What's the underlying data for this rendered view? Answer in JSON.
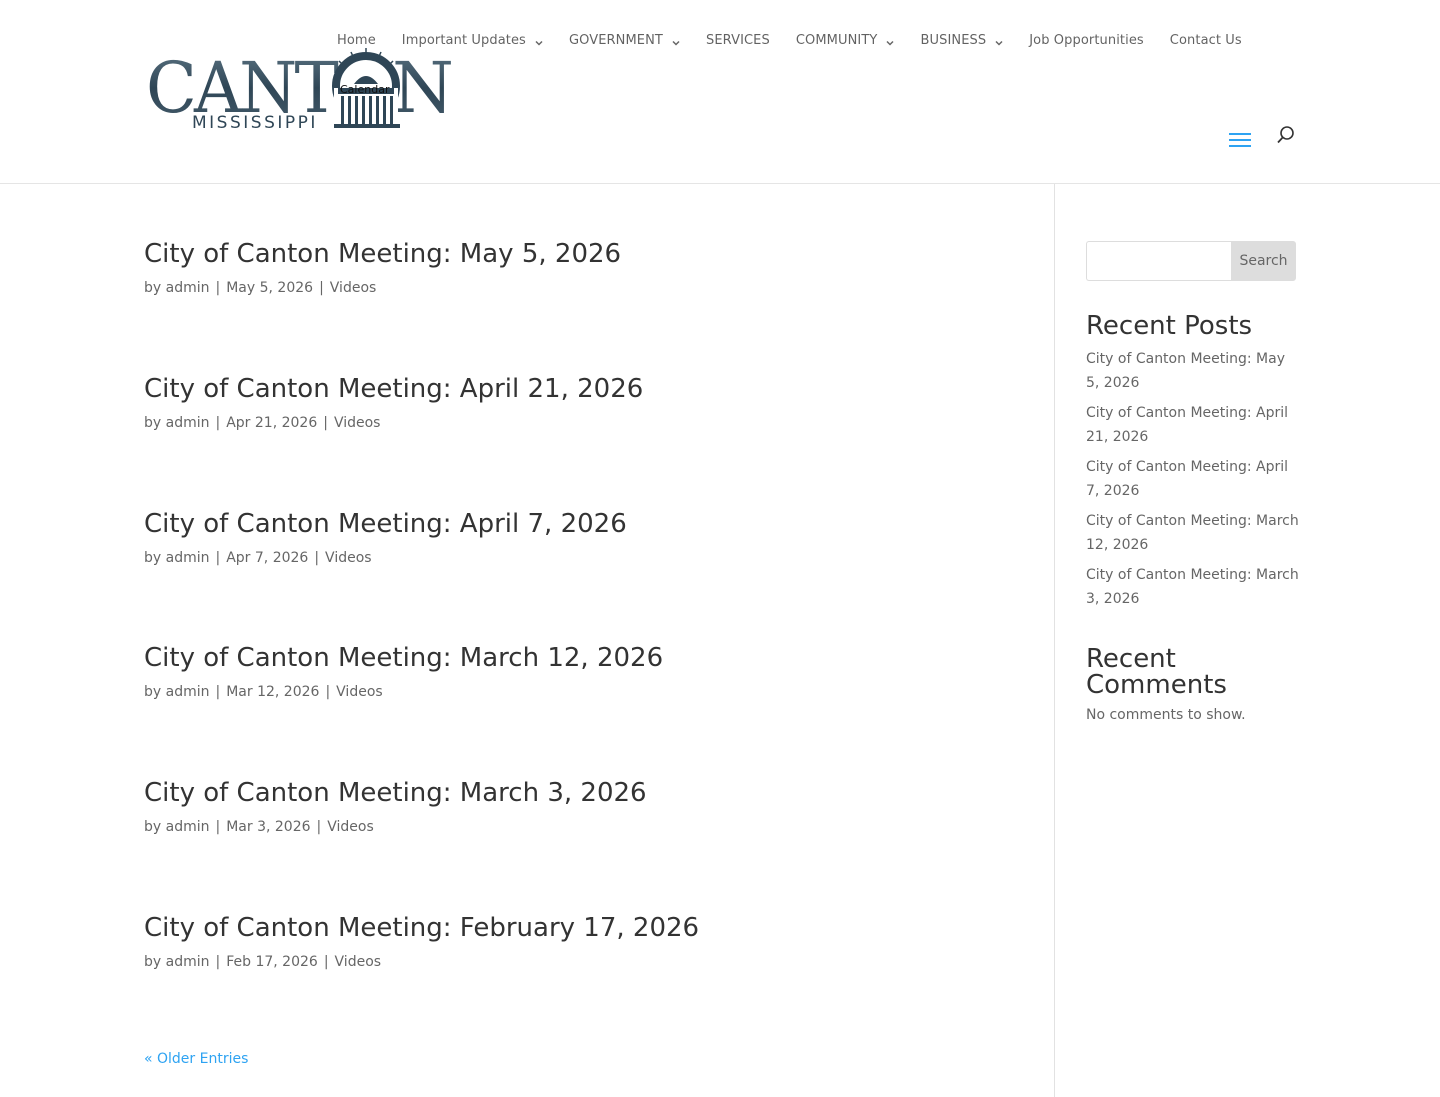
{
  "logo": {
    "name": "CANTON",
    "state": "MISSISSIPPI",
    "overlay": "Calendar"
  },
  "nav": {
    "items": [
      {
        "label": "Home",
        "has_submenu": false
      },
      {
        "label": "Important Updates",
        "has_submenu": true
      },
      {
        "label": "GOVERNMENT",
        "has_submenu": true
      },
      {
        "label": "SERVICES",
        "has_submenu": false
      },
      {
        "label": "COMMUNITY",
        "has_submenu": true
      },
      {
        "label": "BUSINESS",
        "has_submenu": true
      },
      {
        "label": "Job Opportunities",
        "has_submenu": false
      },
      {
        "label": "Contact Us",
        "has_submenu": false
      }
    ],
    "menu_icon": "hamburger-icon",
    "search_icon": "search-icon"
  },
  "posts": [
    {
      "title": "City of Canton Meeting: May 5, 2026",
      "by": "by",
      "author": "admin",
      "date": "May 5, 2026",
      "category": "Videos"
    },
    {
      "title": "City of Canton Meeting: April 21, 2026",
      "by": "by",
      "author": "admin",
      "date": "Apr 21, 2026",
      "category": "Videos"
    },
    {
      "title": "City of Canton Meeting: April 7, 2026",
      "by": "by",
      "author": "admin",
      "date": "Apr 7, 2026",
      "category": "Videos"
    },
    {
      "title": "City of Canton Meeting: March 12, 2026",
      "by": "by",
      "author": "admin",
      "date": "Mar 12, 2026",
      "category": "Videos"
    },
    {
      "title": "City of Canton Meeting: March 3, 2026",
      "by": "by",
      "author": "admin",
      "date": "Mar 3, 2026",
      "category": "Videos"
    },
    {
      "title": "City of Canton Meeting: February 17, 2026",
      "by": "by",
      "author": "admin",
      "date": "Feb 17, 2026",
      "category": "Videos"
    }
  ],
  "pagination": {
    "older_label": "« Older Entries"
  },
  "sidebar": {
    "search": {
      "input_value": "",
      "button_label": "Search"
    },
    "recent_posts": {
      "title": "Recent Posts",
      "items": [
        "City of Canton Meeting: May 5, 2026",
        "City of Canton Meeting: April 21, 2026",
        "City of Canton Meeting: April 7, 2026",
        "City of Canton Meeting: March 12, 2026",
        "City of Canton Meeting: March 3, 2026"
      ]
    },
    "recent_comments": {
      "title": "Recent Comments",
      "empty_text": "No comments to show."
    }
  },
  "colors": {
    "accent": "#2ea3f2",
    "heading": "#333333",
    "body_text": "#666666",
    "logo_steel": "#3d5565"
  }
}
